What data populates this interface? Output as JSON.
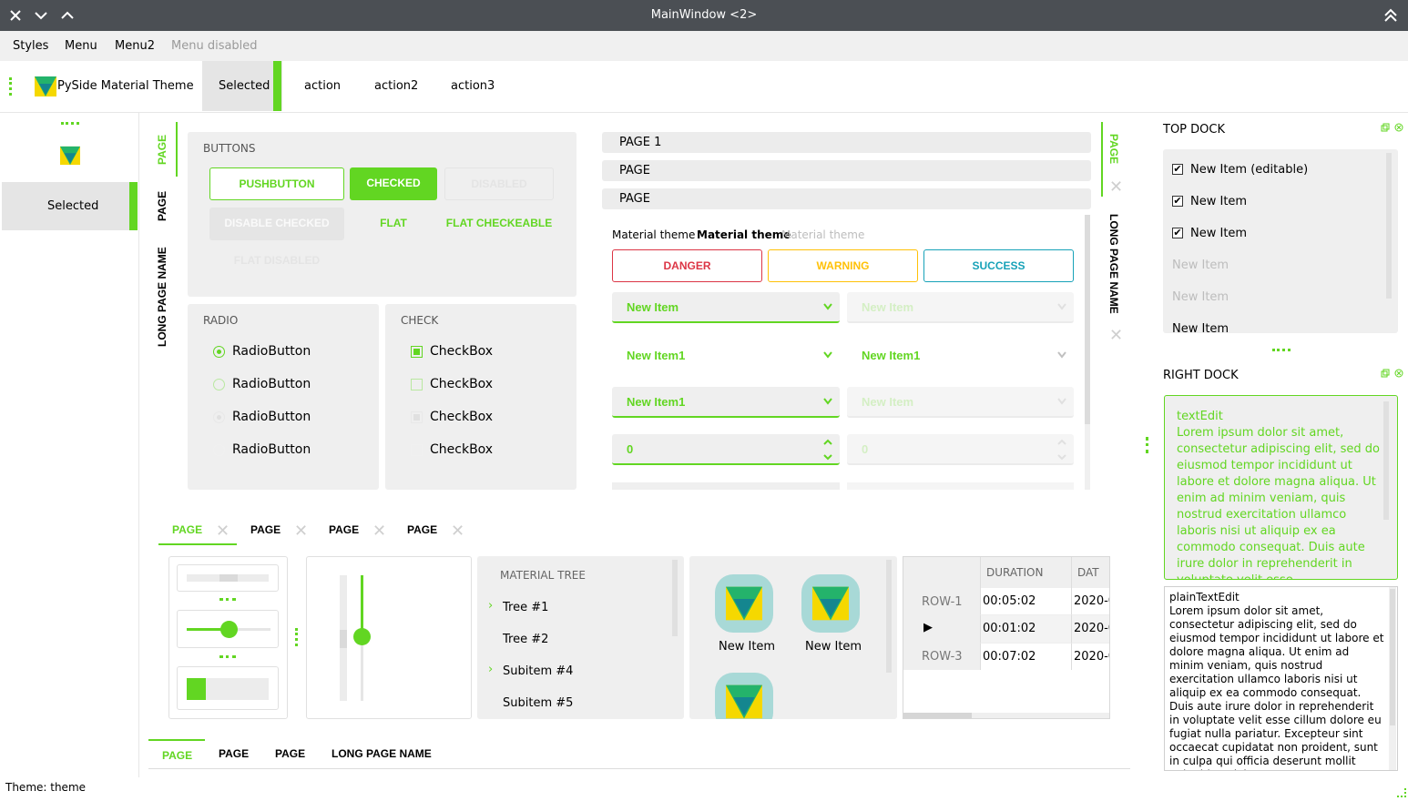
{
  "window": {
    "title": "MainWindow <2>"
  },
  "menu": [
    "Styles",
    "Menu",
    "Menu2",
    "Menu disabled"
  ],
  "toolbar": {
    "app_name": "PySide Material Theme",
    "selected": "Selected",
    "actions": [
      "action",
      "action2",
      "action3"
    ]
  },
  "left_panel": {
    "selected": "Selected"
  },
  "vtabs_left": [
    "PAGE",
    "PAGE",
    "LONG PAGE NAME"
  ],
  "buttons": {
    "caption": "BUTTONS",
    "push": "PUSHBUTTON",
    "checked": "CHECKED",
    "disabled": "DISABLED",
    "disable_checked": "DISABLE CHECKED",
    "flat": "FLAT",
    "flat_checkeable": "FLAT CHECKEABLE",
    "flat_disabled": "FLAT DISABLED"
  },
  "radio": {
    "caption": "RADIO",
    "items": [
      "RadioButton",
      "RadioButton",
      "RadioButton",
      "RadioButton"
    ]
  },
  "check": {
    "caption": "CHECK",
    "items": [
      "CheckBox",
      "CheckBox",
      "CheckBox",
      "CheckBox"
    ]
  },
  "toolbox": [
    "PAGE 1",
    "PAGE",
    "PAGE"
  ],
  "labels": {
    "normal": "Material theme",
    "bold": "Material theme",
    "disabled": "Material theme"
  },
  "status_buttons": {
    "danger": "DANGER",
    "warning": "WARNING",
    "success": "SUCCESS"
  },
  "combos": {
    "c1": "New Item",
    "c2": "New Item",
    "c3": "New Item1",
    "c4": "New Item1",
    "c5": "New Item1",
    "c6": "New Item",
    "spin1": "0",
    "spin2": "0"
  },
  "vtabs_right": [
    "PAGE",
    "LONG PAGE NAME"
  ],
  "bottom_tabs": [
    "PAGE",
    "PAGE",
    "PAGE",
    "PAGE"
  ],
  "tree": {
    "header": "MATERIAL TREE",
    "items": [
      "Tree #1",
      "Tree #2",
      "Subitem #4",
      "Subitem #5"
    ]
  },
  "icons": {
    "labels": [
      "New Item",
      "New Item"
    ]
  },
  "table": {
    "headers": [
      "DURATION",
      "DAT"
    ],
    "rows": [
      {
        "label": "ROW-1",
        "duration": "00:05:02",
        "date": "2020-0"
      },
      {
        "label": "",
        "duration": "00:01:02",
        "date": "2020-0"
      },
      {
        "label": "ROW-3",
        "duration": "00:07:02",
        "date": "2020-0"
      }
    ]
  },
  "south_tabs": [
    "PAGE",
    "PAGE",
    "PAGE",
    "LONG PAGE NAME"
  ],
  "top_dock": {
    "title": "TOP DOCK",
    "items": [
      {
        "label": "New Item (editable)",
        "checked": true
      },
      {
        "label": "New Item",
        "checked": true
      },
      {
        "label": "New Item",
        "checked": true
      },
      {
        "label": "New Item",
        "checked": false
      },
      {
        "label": "New Item",
        "checked": false
      },
      {
        "label": "New Item",
        "checked": false
      }
    ]
  },
  "right_dock": {
    "title": "RIGHT DOCK",
    "text_edit": "textEdit\nLorem ipsum dolor sit amet, consectetur adipiscing elit, sed do eiusmod tempor incididunt ut labore et dolore magna aliqua. Ut enim ad minim veniam, quis nostrud exercitation ullamco laboris nisi ut aliquip ex ea commodo consequat. Duis aute irure dolor in reprehenderit in voluptate velit esse",
    "plain_text_edit": "plainTextEdit\nLorem ipsum dolor sit amet, consectetur adipiscing elit, sed do eiusmod tempor incididunt ut labore et dolore magna aliqua. Ut enim ad minim veniam, quis nostrud exercitation ullamco laboris nisi ut aliquip ex ea commodo consequat. Duis aute irure dolor in reprehenderit in voluptate velit esse cillum dolore eu fugiat nulla pariatur. Excepteur sint occaecat cupidatat non proident, sunt in culpa qui officia deserunt mollit anim id est laborum."
  },
  "status": "Theme: theme",
  "colors": {
    "accent": "#62d622",
    "titlebar": "#4b4f54",
    "danger": "#dc3545",
    "warning": "#ffc107",
    "success": "#17a2b8"
  },
  "sliders": {
    "horizontal": 0.45,
    "vertical": 0.6,
    "progress": 0.1
  }
}
